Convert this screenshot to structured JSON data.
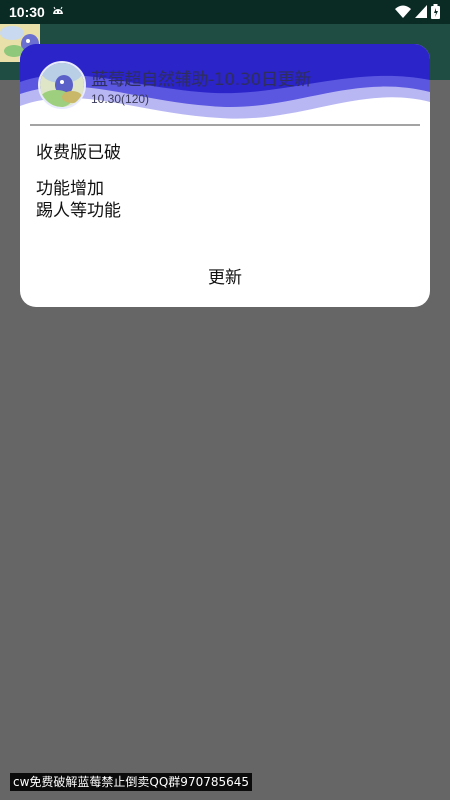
{
  "status_bar": {
    "time": "10:30",
    "icons": [
      "android-icon",
      "wifi-icon",
      "signal-icon",
      "battery-icon"
    ]
  },
  "dialog": {
    "title": "蓝莓超自然辅助-10.30日更新",
    "version": "10.30(120)",
    "body_lines": [
      "收费版已破",
      "功能增加",
      "踢人等功能"
    ],
    "update_button_label": "更新",
    "colors": {
      "wave_dark": "#2b24c8",
      "wave_mid": "#5b57e0",
      "wave_light": "#b9b7f3"
    }
  },
  "watermark": {
    "text": "cw免费破解蓝莓禁止倒卖QQ群970785645"
  },
  "colors": {
    "background_dim": "#666666",
    "status_bar": "#0a2a24",
    "app_bar": "#1f4d44"
  }
}
